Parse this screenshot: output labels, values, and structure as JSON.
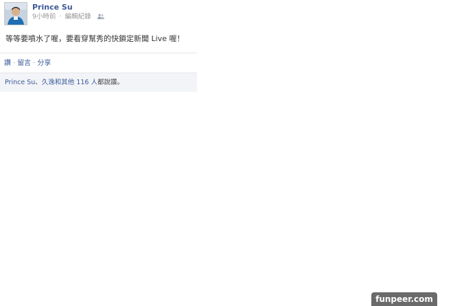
{
  "post": {
    "author": "Prince Su",
    "time": "9小時前",
    "meta_sep": "·",
    "edit_history": "編輯紀錄",
    "message": "等等要噴水了喔，要看穿幫秀的快鎖定新聞 Live 喔！"
  },
  "actions": {
    "like": "讚",
    "comment": "留言",
    "share": "分享",
    "separator": "·"
  },
  "likes": {
    "name": "Prince Su",
    "rest_prefix": "、",
    "others": "久逸和其他 116 人",
    "suffix": "都說讚。"
  },
  "watermark": "funpeer.com",
  "colors": {
    "link": "#3b5998",
    "ufi_background": "#f2f4f8",
    "meta_text": "#999999"
  },
  "icons": {
    "audience": "friends-icon"
  }
}
